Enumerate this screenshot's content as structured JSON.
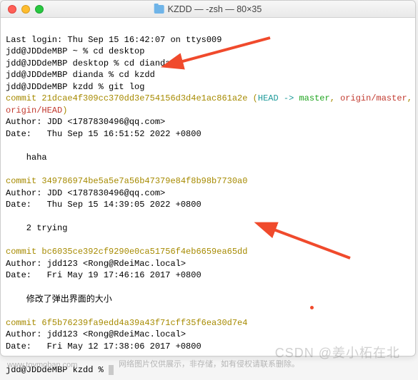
{
  "window": {
    "title": "KZDD — -zsh — 80×35"
  },
  "session": {
    "last_login": "Last login: Thu Sep 15 16:42:07 on ttys009",
    "prompt1": "jdd@JDDdeMBP ~ % cd desktop",
    "prompt2": "jdd@JDDdeMBP desktop % cd dianda",
    "prompt3": "jdd@JDDdeMBP dianda % cd kzdd",
    "prompt4": "jdd@JDDdeMBP kzdd % git log",
    "prompt_end": "jdd@JDDdeMBP kzdd % "
  },
  "commits": [
    {
      "hash_line": "commit 21dcae4f309cc370dd3e754156d3d4e1ac861a2e",
      "refs_open": " (",
      "head": "HEAD -> ",
      "master": "master",
      "sep1": ", ",
      "origin_master": "origin/master",
      "sep2": ", ",
      "origin_head": "origin/HEAD",
      "refs_close": ")",
      "author": "Author: JDD <1787830496@qq.com>",
      "date": "Date:   Thu Sep 15 16:51:52 2022 +0800",
      "message": "    haha"
    },
    {
      "hash_line": "commit 349786974be5a5e7a56b47379e84f8b98b7730a0",
      "author": "Author: JDD <1787830496@qq.com>",
      "date": "Date:   Thu Sep 15 14:39:05 2022 +0800",
      "message": "    2 trying"
    },
    {
      "hash_line": "commit bc6035ce392cf9290e0ca51756f4eb6659ea65dd",
      "author": "Author: jdd123 <Rong@RdeiMac.local>",
      "date": "Date:   Fri May 19 17:46:16 2017 +0800",
      "message": "    修改了弹出界面的大小"
    },
    {
      "hash_line": "commit 6f5b76239fa9edd4a39a43f71cff35f6ea30d7e4",
      "author": "Author: jdd123 <Rong@RdeiMac.local>",
      "date": "Date:   Fri May 12 17:38:06 2017 +0800"
    }
  ],
  "annotations": {
    "arrow_color": "#f04a2c"
  },
  "watermark": "CSDN @姜小柘在北",
  "footer": {
    "left": "www.toymoban.com",
    "center": "网络图片仅供展示，非存储，如有侵权请联系删除。"
  }
}
